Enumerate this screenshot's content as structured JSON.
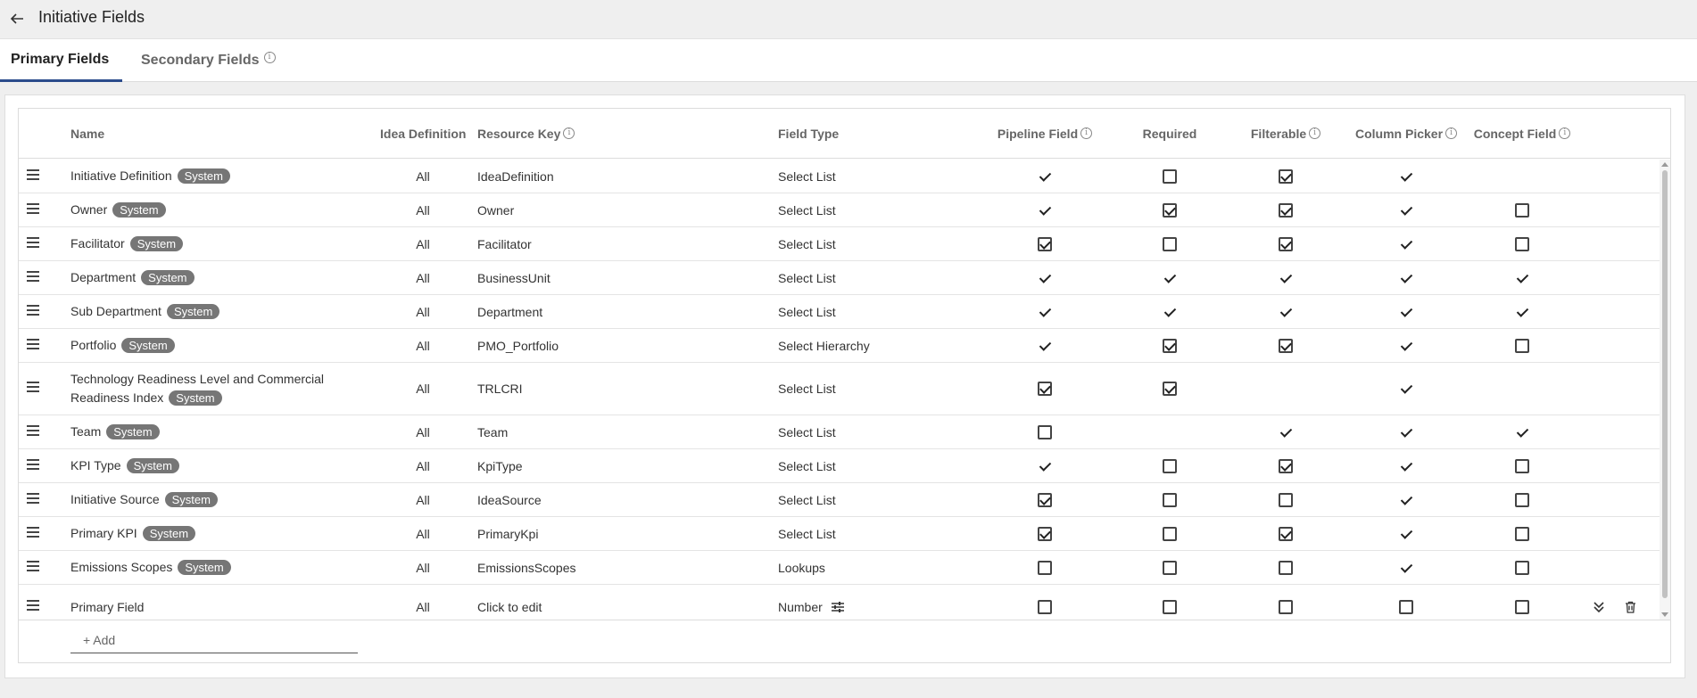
{
  "page": {
    "title": "Initiative Fields"
  },
  "tabs": [
    {
      "label": "Primary Fields"
    },
    {
      "label": "Secondary Fields"
    }
  ],
  "columns": {
    "name": "Name",
    "idea_definition": "Idea Definition",
    "resource_key": "Resource Key",
    "field_type": "Field Type",
    "pipeline_field": "Pipeline Field",
    "required": "Required",
    "filterable": "Filterable",
    "column_picker": "Column Picker",
    "concept_field": "Concept Field"
  },
  "rows": [
    {
      "name": "Initiative Definition",
      "badge": "System",
      "idea_definition": "All",
      "resource_key": "IdeaDefinition",
      "field_type": "Select List",
      "pipeline": "tick",
      "required": "unchecked",
      "filterable": "checked",
      "column_picker": "tick",
      "concept": "none"
    },
    {
      "name": "Owner",
      "badge": "System",
      "idea_definition": "All",
      "resource_key": "Owner",
      "field_type": "Select List",
      "pipeline": "tick",
      "required": "checked",
      "filterable": "checked",
      "column_picker": "tick",
      "concept": "unchecked"
    },
    {
      "name": "Facilitator",
      "badge": "System",
      "idea_definition": "All",
      "resource_key": "Facilitator",
      "field_type": "Select List",
      "pipeline": "checked",
      "required": "unchecked",
      "filterable": "checked",
      "column_picker": "tick",
      "concept": "unchecked"
    },
    {
      "name": "Department",
      "badge": "System",
      "idea_definition": "All",
      "resource_key": "BusinessUnit",
      "field_type": "Select List",
      "pipeline": "tick",
      "required": "tick",
      "filterable": "tick",
      "column_picker": "tick",
      "concept": "tick"
    },
    {
      "name": "Sub Department",
      "badge": "System",
      "idea_definition": "All",
      "resource_key": "Department",
      "field_type": "Select List",
      "pipeline": "tick",
      "required": "tick",
      "filterable": "tick",
      "column_picker": "tick",
      "concept": "tick"
    },
    {
      "name": "Portfolio",
      "badge": "System",
      "idea_definition": "All",
      "resource_key": "PMO_Portfolio",
      "field_type": "Select Hierarchy",
      "pipeline": "tick",
      "required": "checked",
      "filterable": "checked",
      "column_picker": "tick",
      "concept": "unchecked"
    },
    {
      "name_line1": "Technology Readiness Level and Commercial",
      "name_line2": "Readiness Index",
      "badge": "System",
      "idea_definition": "All",
      "resource_key": "TRLCRI",
      "field_type": "Select List",
      "pipeline": "checked",
      "required": "checked",
      "filterable": "none",
      "column_picker": "tick",
      "concept": "none"
    },
    {
      "name": "Team",
      "badge": "System",
      "idea_definition": "All",
      "resource_key": "Team",
      "field_type": "Select List",
      "pipeline": "unchecked",
      "required": "none",
      "filterable": "tick",
      "column_picker": "tick",
      "concept": "tick"
    },
    {
      "name": "KPI Type",
      "badge": "System",
      "idea_definition": "All",
      "resource_key": "KpiType",
      "field_type": "Select List",
      "pipeline": "tick",
      "required": "unchecked",
      "filterable": "checked",
      "column_picker": "tick",
      "concept": "unchecked"
    },
    {
      "name": "Initiative Source",
      "badge": "System",
      "idea_definition": "All",
      "resource_key": "IdeaSource",
      "field_type": "Select List",
      "pipeline": "checked",
      "required": "unchecked",
      "filterable": "unchecked",
      "column_picker": "tick",
      "concept": "unchecked"
    },
    {
      "name": "Primary KPI",
      "badge": "System",
      "idea_definition": "All",
      "resource_key": "PrimaryKpi",
      "field_type": "Select List",
      "pipeline": "checked",
      "required": "unchecked",
      "filterable": "checked",
      "column_picker": "tick",
      "concept": "unchecked"
    },
    {
      "name": "Emissions Scopes",
      "badge": "System",
      "idea_definition": "All",
      "resource_key": "EmissionsScopes",
      "field_type": "Lookups",
      "pipeline": "unchecked",
      "required": "unchecked",
      "filterable": "unchecked",
      "column_picker": "tick",
      "concept": "unchecked"
    },
    {
      "name": "Primary Field",
      "idea_definition": "All",
      "resource_key": "Click to edit",
      "field_type": "Number",
      "pipeline": "unchecked",
      "required": "unchecked",
      "filterable": "unchecked",
      "column_picker": "unchecked",
      "concept": "unchecked"
    }
  ],
  "add_label": "+ Add",
  "icons": {
    "back": "arrow-left-icon",
    "info": "info-icon",
    "drag": "drag-handle-icon",
    "settings": "tune-icon",
    "expand": "double-chevron-down-icon",
    "delete": "trash-icon"
  }
}
